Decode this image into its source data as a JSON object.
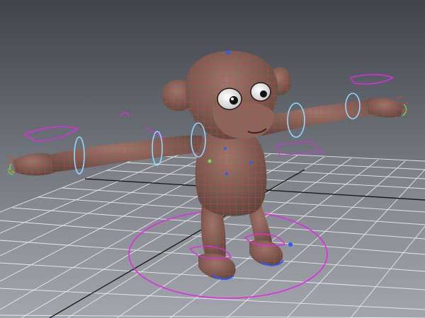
{
  "viewport": {
    "background_top": "#3f434a",
    "background_bottom": "#a4a8ae",
    "grid_color": "#ffffff",
    "grid_axis_color": "#1a1a1a",
    "mesh_fill": "#7a5a52",
    "wireframe_color": "#e0451e",
    "control_curve_magenta": "#e02ae8",
    "control_curve_cyan": "#8fd8ff",
    "joint_blue": "#2b5bff",
    "finger_green": "#6be04a"
  },
  "scene": {
    "object": "monkey-character-rig",
    "display_mode": "wireframe-on-shaded",
    "grid_visible": true
  }
}
